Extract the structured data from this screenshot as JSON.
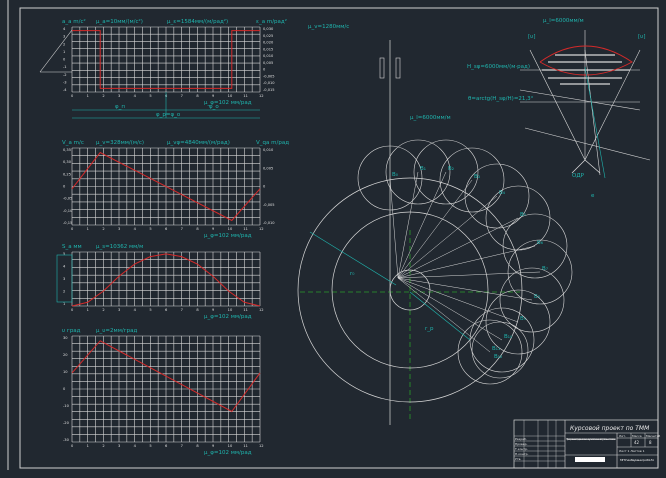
{
  "colors": {
    "background": "#212830",
    "grid": "#d8d8d8",
    "curve": "#d42a2a",
    "annotation": "#1fb5ae",
    "green": "#2a9a2a"
  },
  "graphs": [
    {
      "id": "acceleration",
      "ylabel": "a_a m/c²",
      "scale_y": "μ_a=10мм/(м/с²)",
      "scale_right": "μ_ε=1584мм/(м/рад²)",
      "right_label": "ε_a m/рад²",
      "x_scale": "μ_φ=102 мм/рад",
      "yticks": [
        "4",
        "3",
        "2",
        "1",
        "0",
        "-1",
        "-2",
        "-3",
        "-4"
      ],
      "right_ticks": [
        "0,030",
        "0,025",
        "0,020",
        "0,015",
        "0,010",
        "0,005",
        "0",
        "-0,005",
        "-0,010",
        "-0,015"
      ],
      "xticks": [
        "0",
        "1",
        "2",
        "3",
        "4",
        "5",
        "6",
        "7",
        "8",
        "9",
        "10",
        "11",
        "12"
      ],
      "dims": [
        "φ_п",
        "φ_о",
        "φ_р=φ_о"
      ],
      "points": [
        [
          0,
          4
        ],
        [
          1.8,
          4
        ],
        [
          1.8,
          -4
        ],
        [
          10.2,
          -4
        ],
        [
          10.2,
          4
        ],
        [
          12,
          4
        ]
      ],
      "ylim": [
        -4.5,
        4.5
      ]
    },
    {
      "id": "velocity",
      "ylabel": "V_a m/c",
      "scale_y": "μ_v=328мм/(м/с)",
      "scale_right": "μ_vφ=4840мм/(м/рад)",
      "right_label": "V_qa m/рад",
      "x_scale": "μ_φ=102 мм/рад",
      "yticks": [
        "0,35",
        "0,30",
        "0,25",
        "0",
        "-0,05",
        "-0,10",
        "-0,15"
      ],
      "right_ticks": [
        "0,010",
        "0,005",
        "0",
        "-0,005",
        "-0,010"
      ],
      "xticks": [
        "0",
        "1",
        "2",
        "3",
        "4",
        "5",
        "6",
        "7",
        "8",
        "9",
        "10",
        "11",
        "12"
      ],
      "points": [
        [
          0,
          0
        ],
        [
          1.8,
          0.32
        ],
        [
          10.2,
          -0.28
        ],
        [
          12,
          0
        ]
      ],
      "ylim": [
        -0.32,
        0.36
      ]
    },
    {
      "id": "displacement",
      "ylabel": "S_a мм",
      "scale_y": "μ_s=10362 мм/м",
      "x_scale": "μ_φ=102 мм/рад",
      "yticks": [
        "5",
        "4",
        "3",
        "2",
        "1"
      ],
      "xticks": [
        "0",
        "1",
        "2",
        "3",
        "4",
        "5",
        "6",
        "7",
        "8",
        "9",
        "10",
        "11",
        "12"
      ],
      "points": [
        [
          0,
          0
        ],
        [
          1,
          0.4
        ],
        [
          2,
          1.6
        ],
        [
          3,
          3.2
        ],
        [
          4,
          4.5
        ],
        [
          5,
          5.3
        ],
        [
          6,
          5.6
        ],
        [
          7,
          5.3
        ],
        [
          8,
          4.5
        ],
        [
          9,
          3.2
        ],
        [
          10,
          1.6
        ],
        [
          11,
          0.4
        ],
        [
          12,
          0
        ]
      ],
      "ylim": [
        0,
        5.8
      ]
    },
    {
      "id": "pressure-angle",
      "ylabel": "υ град",
      "scale_y": "μ_υ=2мм/град",
      "x_scale": "μ_φ=102 мм/рад",
      "yticks": [
        "30",
        "20",
        "10",
        "0",
        "-10",
        "-20",
        "-30"
      ],
      "xticks": [
        "0",
        "1",
        "2",
        "3",
        "4",
        "5",
        "6",
        "7",
        "8",
        "9",
        "10",
        "11",
        "12"
      ],
      "points": [
        [
          0,
          10
        ],
        [
          1.8,
          30
        ],
        [
          10.2,
          -14
        ],
        [
          12,
          10
        ]
      ],
      "ylim": [
        -33,
        33
      ]
    }
  ],
  "mechanism": {
    "mu_l": "μ_l=6000мм/м",
    "mu_top": "μ_l=6000мм/м",
    "mu_sq": "H_sφ=6000мм/(м·рад)",
    "theta": "θ=arctg(H_sφ/H)=21,3°",
    "v_scale": "μ_v=1280мм/с",
    "r0": "r₀",
    "rp": "r_р",
    "odr": "ОДР",
    "e": "e",
    "angle_marks": [
      "[υ]",
      "[υ]"
    ],
    "point_labels": [
      "B₀",
      "B₁",
      "B₂",
      "B₃",
      "B₄",
      "B₅",
      "B₆",
      "B₇",
      "B₈",
      "B₉",
      "B₁₀",
      "B₁₁",
      "B₁₂"
    ]
  },
  "title_block": {
    "title": "Курсовой проект по ТММ",
    "description": "Проектирование и исследование механизмов кулачкового механизма с поступательным толкателем",
    "sheet": "42",
    "sheets": "8",
    "sheet_label": "Лист 1 Листов 1",
    "org": "МГТУ им.Баумана гр.АК1-51",
    "cols": [
      "Лит.",
      "Масса",
      "Масштаб"
    ],
    "rows": [
      "Разраб.",
      "Провер.",
      "Т.контр.",
      "Н.контр.",
      "Утв."
    ]
  }
}
